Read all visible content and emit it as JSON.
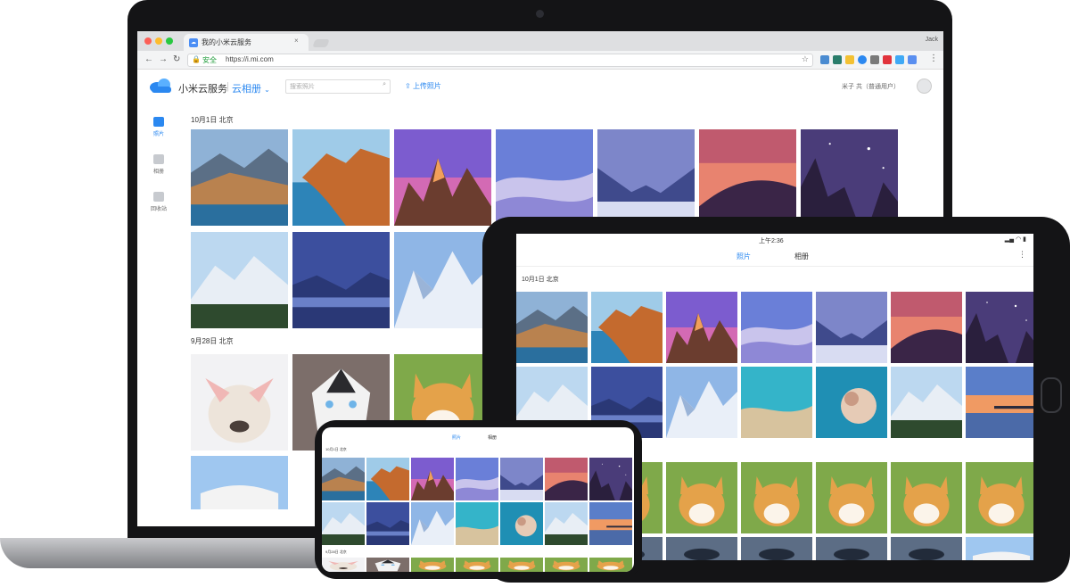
{
  "colors": {
    "accent": "#2b88f0",
    "device_black": "#141416",
    "laptop_silver": "#b9babd"
  },
  "browser": {
    "tab_title": "我的小米云服务",
    "tab_close": "×",
    "window_user": "Jack",
    "secure_label": "安全",
    "url": "https://i.mi.com",
    "nav": {
      "back": "←",
      "forward": "→",
      "reload": "↻"
    },
    "star_icon": "☆",
    "menu_icon": "⋮"
  },
  "app": {
    "brand": "小米云服务",
    "separator": "|",
    "section": "云相册",
    "search_placeholder": "搜索照片",
    "upload_label": "上传照片",
    "account": "米子 共（普通用户）",
    "sidebar": [
      {
        "label": "照片",
        "icon": "photo-icon"
      },
      {
        "label": "相册",
        "icon": "album-icon"
      },
      {
        "label": "回收站",
        "icon": "trash-icon"
      }
    ],
    "groups": [
      {
        "label": "10月1日  北京"
      },
      {
        "label": "9月28日  北京"
      }
    ]
  },
  "tablet": {
    "status_time": "上午2:36",
    "tabs": [
      "照片",
      "相册"
    ],
    "group_label": "10月1日 北京"
  },
  "phone": {
    "tabs": [
      "照片",
      "相册"
    ],
    "group_label": "10月1日 北京",
    "group2_label": "9月28日 北京"
  }
}
